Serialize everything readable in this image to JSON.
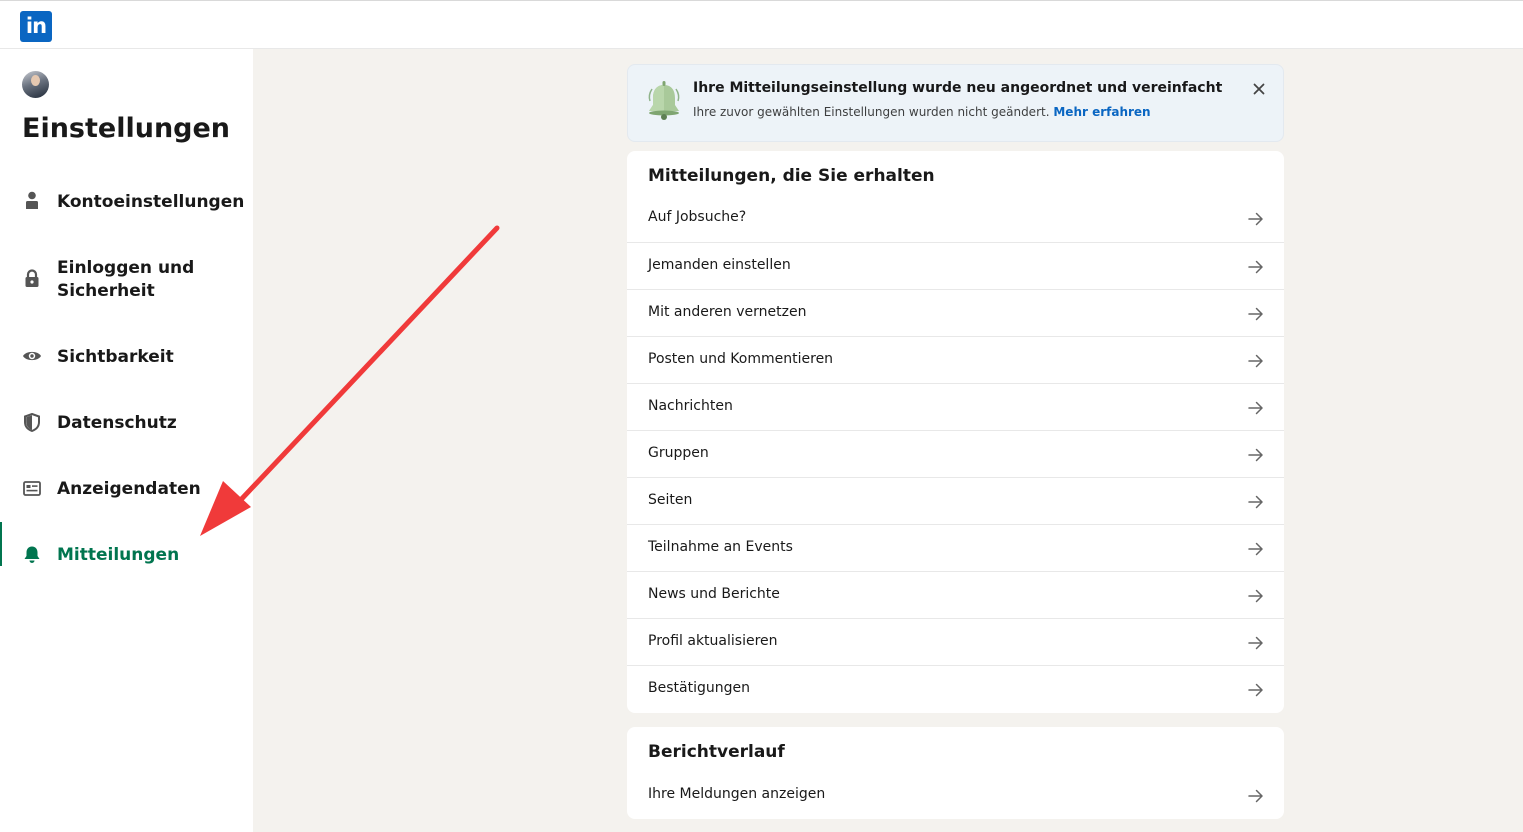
{
  "header": {
    "logo_text": "in",
    "logo_icon": "linkedin-logo-icon",
    "brand_color": "#0a66c2"
  },
  "sidebar": {
    "page_title": "Einstellungen",
    "active_color": "#01754f",
    "items": [
      {
        "label": "Kontoeinstellungen",
        "icon": "person-icon",
        "active": false
      },
      {
        "label": "Einloggen und Sicherheit",
        "line1": "Einloggen und",
        "line2": "Sicherheit",
        "icon": "lock-icon",
        "active": false
      },
      {
        "label": "Sichtbarkeit",
        "icon": "eye-icon",
        "active": false
      },
      {
        "label": "Datenschutz",
        "icon": "shield-icon",
        "active": false
      },
      {
        "label": "Anzeigendaten",
        "icon": "ad-icon",
        "active": false
      },
      {
        "label": "Mitteilungen",
        "icon": "bell-icon",
        "active": true
      }
    ]
  },
  "notice": {
    "title": "Ihre Mitteilungseinstellung wurde neu angeordnet und vereinfacht",
    "text": "Ihre zuvor gewählten Einstellungen wurden nicht geändert.",
    "link": "Mehr erfahren",
    "icon": "bell-illustration-icon",
    "close_icon": "close-icon"
  },
  "notifications_card": {
    "title": "Mitteilungen, die Sie erhalten",
    "rows": [
      "Auf Jobsuche?",
      "Jemanden einstellen",
      "Mit anderen vernetzen",
      "Posten und Kommentieren",
      "Nachrichten",
      "Gruppen",
      "Seiten",
      "Teilnahme an Events",
      "News und Berichte",
      "Profil aktualisieren",
      "Bestätigungen"
    ]
  },
  "report_card": {
    "title": "Berichtverlauf",
    "rows": [
      "Ihre Meldungen anzeigen"
    ]
  },
  "annotation": {
    "arrow_color": "#f03a3a"
  }
}
